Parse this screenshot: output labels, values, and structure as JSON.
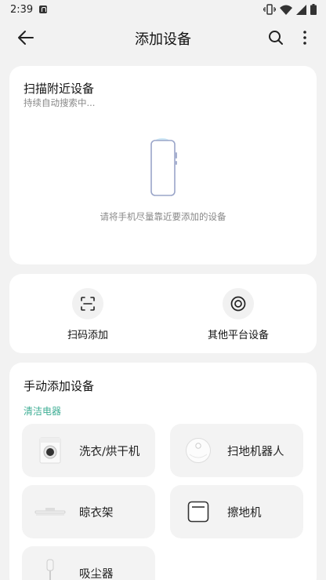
{
  "status_bar": {
    "time": "2:39"
  },
  "header": {
    "title": "添加设备"
  },
  "scan_card": {
    "title": "扫描附近设备",
    "subtitle": "持续自动搜索中...",
    "hint": "请将手机尽量靠近要添加的设备"
  },
  "actions": [
    {
      "label": "扫码添加",
      "icon": "qr-scan-icon"
    },
    {
      "label": "其他平台设备",
      "icon": "other-platform-icon"
    }
  ],
  "manual": {
    "title": "手动添加设备",
    "category": "清洁电器",
    "devices": [
      {
        "label": "洗衣/烘干机",
        "icon": "washing-machine-icon"
      },
      {
        "label": "扫地机器人",
        "icon": "robot-vacuum-icon"
      },
      {
        "label": "晾衣架",
        "icon": "drying-rack-icon"
      },
      {
        "label": "擦地机",
        "icon": "floor-mopper-icon"
      },
      {
        "label": "吸尘器",
        "icon": "vacuum-cleaner-icon"
      }
    ]
  }
}
